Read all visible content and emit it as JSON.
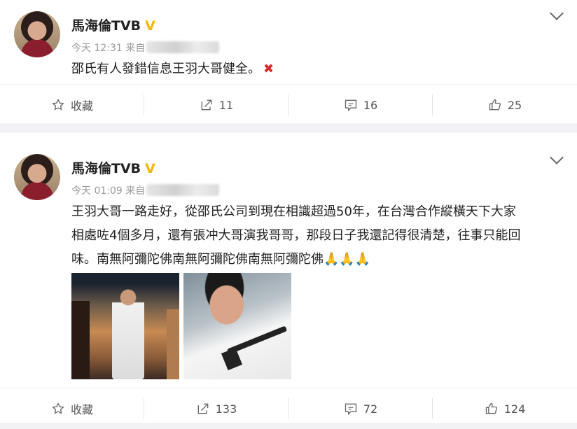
{
  "posts": [
    {
      "author": "馬海倫TVB",
      "time": "今天 12:31",
      "source_prefix": "来自",
      "text": "邵氏有人發錯信息王羽大哥健全。",
      "text_mark": "✖",
      "actions": {
        "favorite": "收藏",
        "repost": "11",
        "comment": "16",
        "like": "25"
      }
    },
    {
      "author": "馬海倫TVB",
      "time": "今天 01:09",
      "source_prefix": "来自",
      "text_lines": [
        "王羽大哥一路走好，從邵氏公司到現在相識超過50年，在台灣合作縱橫天下大家",
        "相處咗4個多月，還有張冲大哥演我哥哥，那段日子我還記得很清楚，往事只能回",
        "味。南無阿彌陀佛南無阿彌陀佛南無阿彌陀佛🙏🙏🙏"
      ],
      "actions": {
        "favorite": "收藏",
        "repost": "133",
        "comment": "72",
        "like": "124"
      }
    }
  ],
  "colors": {
    "verified": "#f6b700",
    "mark": "#d42a2a",
    "bg": "#f2f2f5"
  }
}
